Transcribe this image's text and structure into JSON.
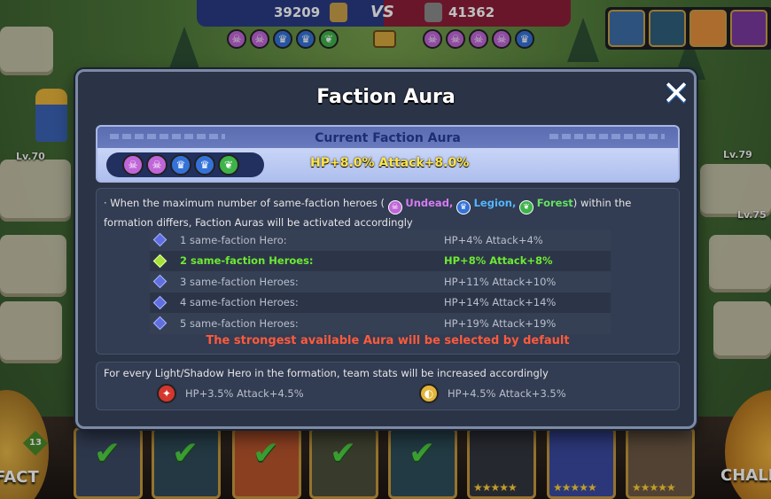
{
  "top_bar": {
    "left_score": "39209",
    "vs_label": "VS",
    "right_score": "41362",
    "left_factions": [
      "undead",
      "undead",
      "legion",
      "legion",
      "forest"
    ],
    "right_factions": [
      "undead",
      "undead",
      "undead",
      "undead",
      "legion"
    ]
  },
  "modal": {
    "title": "Faction Aura",
    "close_label": "✕",
    "current": {
      "title": "Current Faction Aura",
      "icons": [
        "undead",
        "undead",
        "legion",
        "legion",
        "forest"
      ],
      "stat": "HP+8.0% Attack+8.0%"
    },
    "desc": {
      "prefix": "· When the maximum number of same-faction heroes (",
      "undead": "Undead,",
      "legion": "Legion,",
      "forest": "Forest",
      "suffix": ") within the formation differs, Faction Auras will be activated accordingly"
    },
    "tiers": [
      {
        "label": "1 same-faction Hero:",
        "bonus": "HP+4% Attack+4%"
      },
      {
        "label": "2 same-faction Heroes:",
        "bonus": "HP+8% Attack+8%"
      },
      {
        "label": "3 same-faction Heroes:",
        "bonus": "HP+11% Attack+10%"
      },
      {
        "label": "4 same-faction Heroes:",
        "bonus": "HP+14% Attack+14%"
      },
      {
        "label": "5 same-faction Heroes:",
        "bonus": "HP+19% Attack+19%"
      }
    ],
    "active_tier": 1,
    "note": "The strongest available Aura will be selected by default",
    "light_shadow": {
      "desc": "For every Light/Shadow Hero in the formation, team stats will be increased accordingly",
      "light_bonus": "HP+3.5% Attack+4.5%",
      "shadow_bonus": "HP+4.5% Attack+3.5%"
    }
  },
  "scene": {
    "levels": [
      "Lv.70",
      "Lv.79",
      "Lv.75"
    ],
    "left_button": "FACT",
    "left_badge": "13",
    "right_button": "CHALL"
  },
  "colors": {
    "undead": "#c066d8",
    "legion": "#3472d8",
    "forest": "#3fb24a",
    "active_tier": "#6dea33",
    "note": "#ff5a3c",
    "current_stat": "#ffe54a"
  }
}
